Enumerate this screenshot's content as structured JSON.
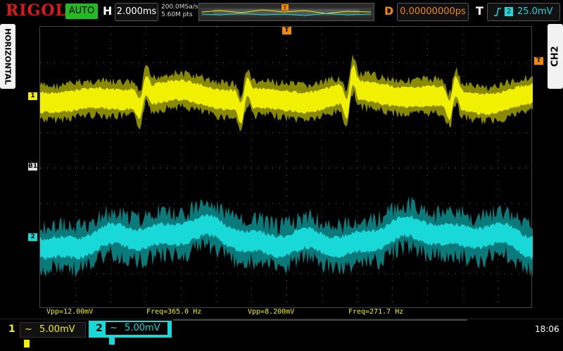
{
  "header": {
    "brand": "RIGOL",
    "run_state": "AUTO",
    "horizontal_letter": "H",
    "timebase": "2.000ms",
    "sample_rate": "200.0MSa/s",
    "memory_depth": "5.60M pts",
    "delay_letter": "D",
    "delay_value": "0.00000000ps",
    "trigger_letter": "T",
    "trigger_source": "2",
    "trigger_level": "25.0mV",
    "memory_marker": "T"
  },
  "side": {
    "left_label": "HORIZONTAL",
    "right_label": "CH2"
  },
  "markers": {
    "ch1": "1",
    "bus": "B1",
    "ch2": "2",
    "trigger_level_marker": "T",
    "trigger_position_marker": "T"
  },
  "measurements": {
    "vpp1": "Vpp=12.00mV",
    "freq1": "Freq=365.0 Hz",
    "vpp2": "Vpp=8.200mV",
    "freq2": "Freq=271.7 Hz"
  },
  "channels": [
    {
      "num": "1",
      "coupling": "~",
      "scale": "5.00mV"
    },
    {
      "num": "2",
      "coupling": "~",
      "scale": "5.00mV"
    }
  ],
  "clock": "18:06",
  "colors": {
    "ch1": "#f0f000",
    "ch2": "#18d8d8",
    "trigger": "#f08a00",
    "run": "#22bb22",
    "brand": "#e01818"
  }
}
